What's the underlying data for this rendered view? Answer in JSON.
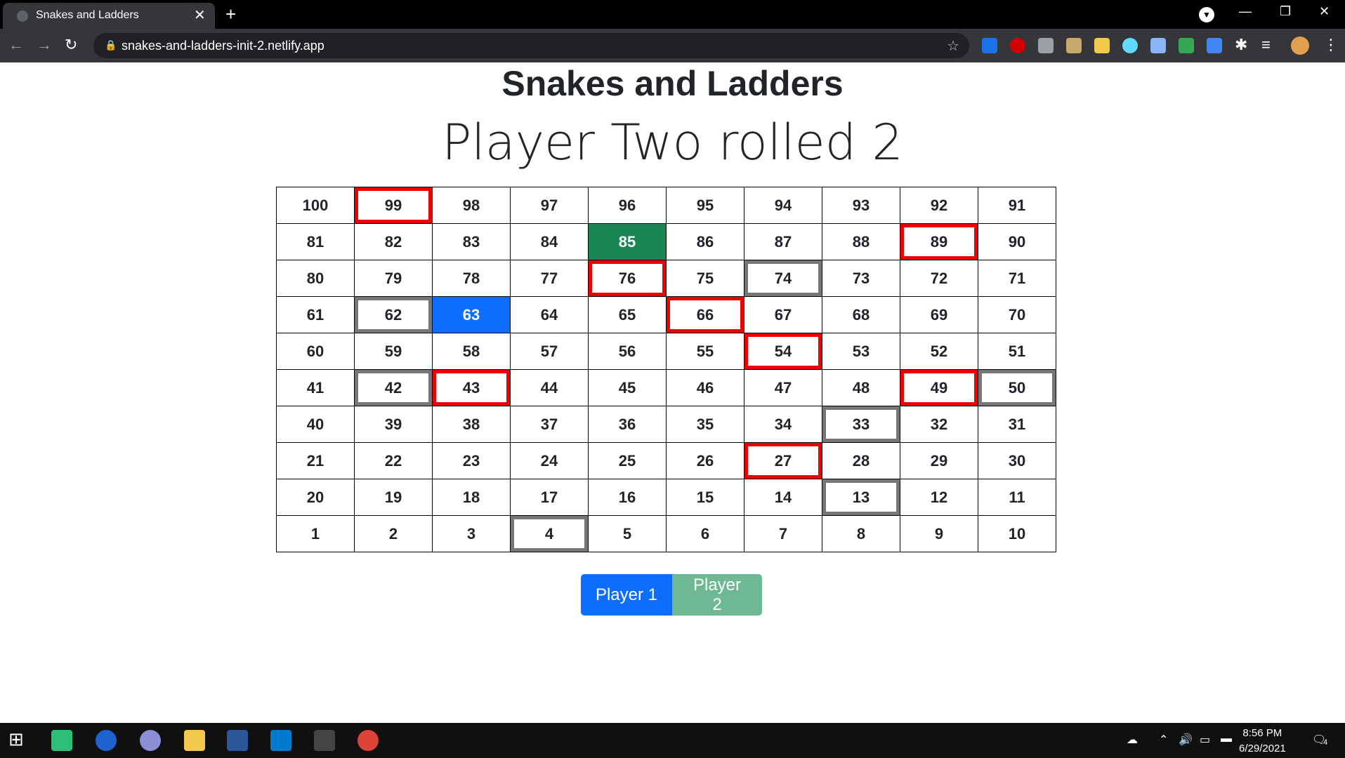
{
  "browser": {
    "tab_title": "Snakes and Ladders",
    "url": "snakes-and-ladders-init-2.netlify.app"
  },
  "page": {
    "title": "Snakes and Ladders",
    "status": "Player Two rolled 2"
  },
  "board": {
    "rows": [
      [
        100,
        99,
        98,
        97,
        96,
        95,
        94,
        93,
        92,
        91
      ],
      [
        81,
        82,
        83,
        84,
        85,
        86,
        87,
        88,
        89,
        90
      ],
      [
        80,
        79,
        78,
        77,
        76,
        75,
        74,
        73,
        72,
        71
      ],
      [
        61,
        62,
        63,
        64,
        65,
        66,
        67,
        68,
        69,
        70
      ],
      [
        60,
        59,
        58,
        57,
        56,
        55,
        54,
        53,
        52,
        51
      ],
      [
        41,
        42,
        43,
        44,
        45,
        46,
        47,
        48,
        49,
        50
      ],
      [
        40,
        39,
        38,
        37,
        36,
        35,
        34,
        33,
        32,
        31
      ],
      [
        21,
        22,
        23,
        24,
        25,
        26,
        27,
        28,
        29,
        30
      ],
      [
        20,
        19,
        18,
        17,
        16,
        15,
        14,
        13,
        12,
        11
      ],
      [
        1,
        2,
        3,
        4,
        5,
        6,
        7,
        8,
        9,
        10
      ]
    ],
    "snake_squares": [
      99,
      89,
      76,
      66,
      54,
      43,
      49,
      27
    ],
    "ladder_squares": [
      74,
      62,
      42,
      50,
      33,
      13,
      4
    ],
    "player_one_square": 63,
    "player_two_square": 85,
    "colors": {
      "player_one": "#0d6efd",
      "player_two": "#198754",
      "snake_border": "#e00000",
      "ladder_border": "#777777"
    }
  },
  "buttons": {
    "player1": "Player 1",
    "player2": "Player 2"
  },
  "taskbar": {
    "time": "8:56 PM",
    "date": "6/29/2021",
    "notifications": "4"
  }
}
